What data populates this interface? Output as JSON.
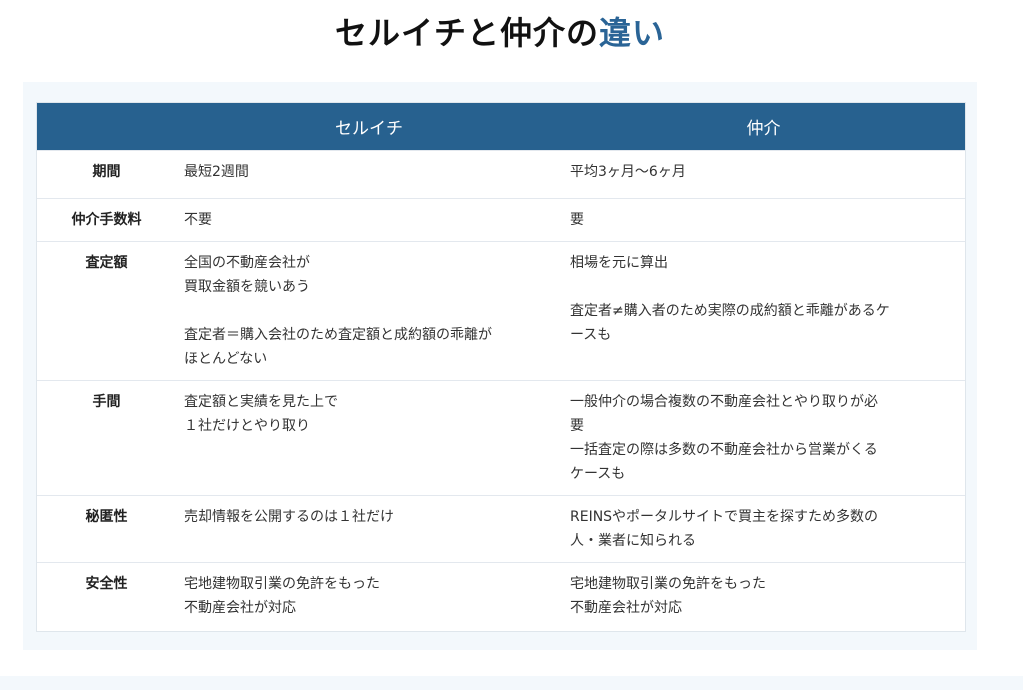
{
  "title": {
    "main": "セルイチと仲介の",
    "accent": "違い"
  },
  "table": {
    "headers": [
      "",
      "セルイチ",
      "仲介"
    ],
    "rows": [
      {
        "label": "期間",
        "col1": [
          "最短2週間"
        ],
        "col2": [
          "平均3ヶ月〜6ヶ月"
        ]
      },
      {
        "label": "仲介手数料",
        "col1": [
          "不要"
        ],
        "col2": [
          "要"
        ]
      },
      {
        "label": "査定額",
        "col1": [
          "全国の不動産会社が",
          "買取金額を競いあう",
          "",
          "査定者＝購入会社のため査定額と成約額の乖離が",
          "ほとんどない"
        ],
        "col2": [
          "相場を元に算出",
          "",
          "査定者≠購入者のため実際の成約額と乖離があるケ",
          "ースも"
        ]
      },
      {
        "label": "手間",
        "col1": [
          "査定額と実績を見た上で",
          "１社だけとやり取り"
        ],
        "col2": [
          "一般仲介の場合複数の不動産会社とやり取りが必",
          "要",
          "一括査定の際は多数の不動産会社から営業がくる",
          "ケースも"
        ]
      },
      {
        "label": "秘匿性",
        "col1": [
          "売却情報を公開するのは１社だけ"
        ],
        "col2": [
          "REINSやポータルサイトで買主を探すため多数の",
          "人・業者に知られる"
        ]
      },
      {
        "label": "安全性",
        "col1": [
          "宅地建物取引業の免許をもった",
          "不動産会社が対応"
        ],
        "col2": [
          "宅地建物取引業の免許をもった",
          "不動産会社が対応"
        ]
      }
    ]
  }
}
